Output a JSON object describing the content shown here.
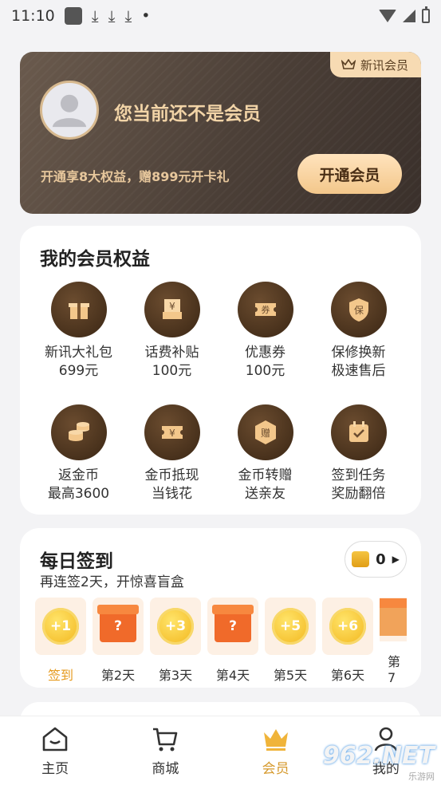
{
  "status_bar": {
    "time": "11:10",
    "dots": "•"
  },
  "vip_card": {
    "brand_tag": "新讯会员",
    "status": "您当前还不是会员",
    "promo": "开通享8大权益，赠899元开卡礼",
    "open_button": "开通会员"
  },
  "benefits": {
    "title": "我的会员权益",
    "items": [
      {
        "icon": "gift-icon",
        "label": "新讯大礼包",
        "sub": "699元"
      },
      {
        "icon": "bill-subsidy-icon",
        "label": "话费补贴",
        "sub": "100元"
      },
      {
        "icon": "coupon-icon",
        "label": "优惠券",
        "sub": "100元"
      },
      {
        "icon": "warranty-shield-icon",
        "label": "保修换新",
        "sub": "极速售后"
      },
      {
        "icon": "coin-stack-icon",
        "label": "返金币",
        "sub": "最高3600"
      },
      {
        "icon": "cash-ticket-icon",
        "label": "金币抵现",
        "sub": "当钱花"
      },
      {
        "icon": "gift-coin-icon",
        "label": "金币转赠",
        "sub": "送亲友"
      },
      {
        "icon": "calendar-check-icon",
        "label": "签到任务",
        "sub": "奖励翻倍"
      }
    ]
  },
  "checkin": {
    "title": "每日签到",
    "subtitle": "再连签2天，开惊喜盲盒",
    "coin_count": "0",
    "days": [
      {
        "reward": "+1",
        "label": "签到"
      },
      {
        "reward": "?",
        "label": "第2天"
      },
      {
        "reward": "+3",
        "label": "第3天"
      },
      {
        "reward": "?",
        "label": "第4天"
      },
      {
        "reward": "+5",
        "label": "第5天"
      },
      {
        "reward": "+6",
        "label": "第6天"
      },
      {
        "reward": "",
        "label": "第7"
      }
    ]
  },
  "tabbar": {
    "tabs": [
      {
        "label": "主页",
        "icon": "home-icon"
      },
      {
        "label": "商城",
        "icon": "cart-icon"
      },
      {
        "label": "会员",
        "icon": "crown-icon"
      },
      {
        "label": "我的",
        "icon": "profile-icon"
      }
    ],
    "active": "会员"
  },
  "watermark": {
    "number": "962.NET",
    "text": "乐游网"
  },
  "colors": {
    "accent_gold": "#d69a2e",
    "card_dark": "#4b3f37",
    "button_gold": "#f3c78b"
  }
}
